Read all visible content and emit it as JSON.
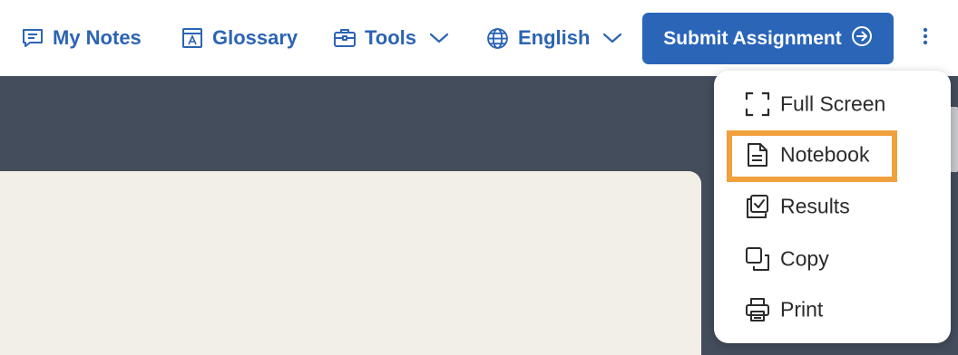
{
  "topbar": {
    "my_notes": "My Notes",
    "glossary": "Glossary",
    "tools": "Tools",
    "language": "English",
    "submit": "Submit Assignment"
  },
  "menu": {
    "items": [
      {
        "label": "Full Screen",
        "icon": "full-screen-icon"
      },
      {
        "label": "Notebook",
        "icon": "notebook-icon",
        "highlighted": true
      },
      {
        "label": "Results",
        "icon": "results-icon"
      },
      {
        "label": "Copy",
        "icon": "copy-icon"
      },
      {
        "label": "Print",
        "icon": "print-icon"
      }
    ]
  },
  "colors": {
    "brand_blue": "#2a65b8",
    "link_blue": "#2c64b4",
    "dark_bg": "#444d5c",
    "paper": "#f2f0e6",
    "highlight": "#f0a03c"
  }
}
